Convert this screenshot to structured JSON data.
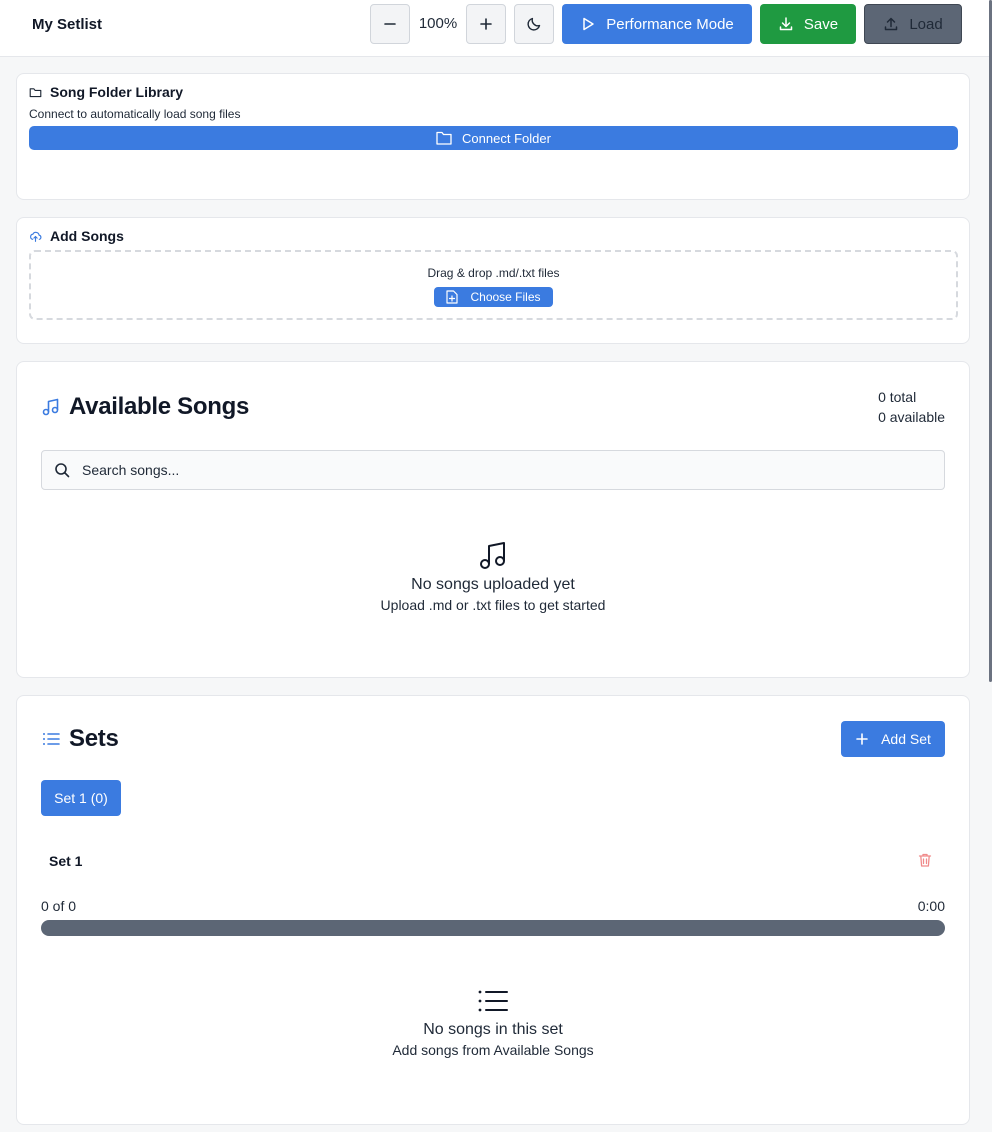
{
  "app": {
    "title": "My Setlist"
  },
  "toolbar": {
    "zoom_out_icon": "minus-icon",
    "zoom_level": "100%",
    "zoom_in_icon": "plus-icon",
    "theme_icon": "moon-icon",
    "performance_label": "Performance Mode",
    "save_label": "Save",
    "load_label": "Load",
    "accent": "#3b7be0",
    "save_color": "#1f9a41",
    "load_color": "#5c6675"
  },
  "folder_library": {
    "title": "Song Folder Library",
    "description": "Connect to automatically load song files",
    "connect_label": "Connect Folder"
  },
  "add_songs": {
    "title": "Add Songs",
    "drop_text": "Drag & drop .md/.txt files",
    "choose_label": "Choose Files"
  },
  "available_songs": {
    "title": "Available Songs",
    "total": "0 total",
    "available": "0 available",
    "search_placeholder": "Search songs...",
    "empty_title": "No songs uploaded yet",
    "empty_subtitle": "Upload .md or .txt files to get started"
  },
  "sets": {
    "title": "Sets",
    "add_label": "Add Set",
    "tabs": [
      {
        "label": "Set 1 (0)"
      }
    ],
    "active": {
      "name": "Set 1",
      "progress_text": "0 of 0",
      "duration": "0:00",
      "progress": 0,
      "empty_title": "No songs in this set",
      "empty_subtitle": "Add songs from Available Songs"
    }
  }
}
